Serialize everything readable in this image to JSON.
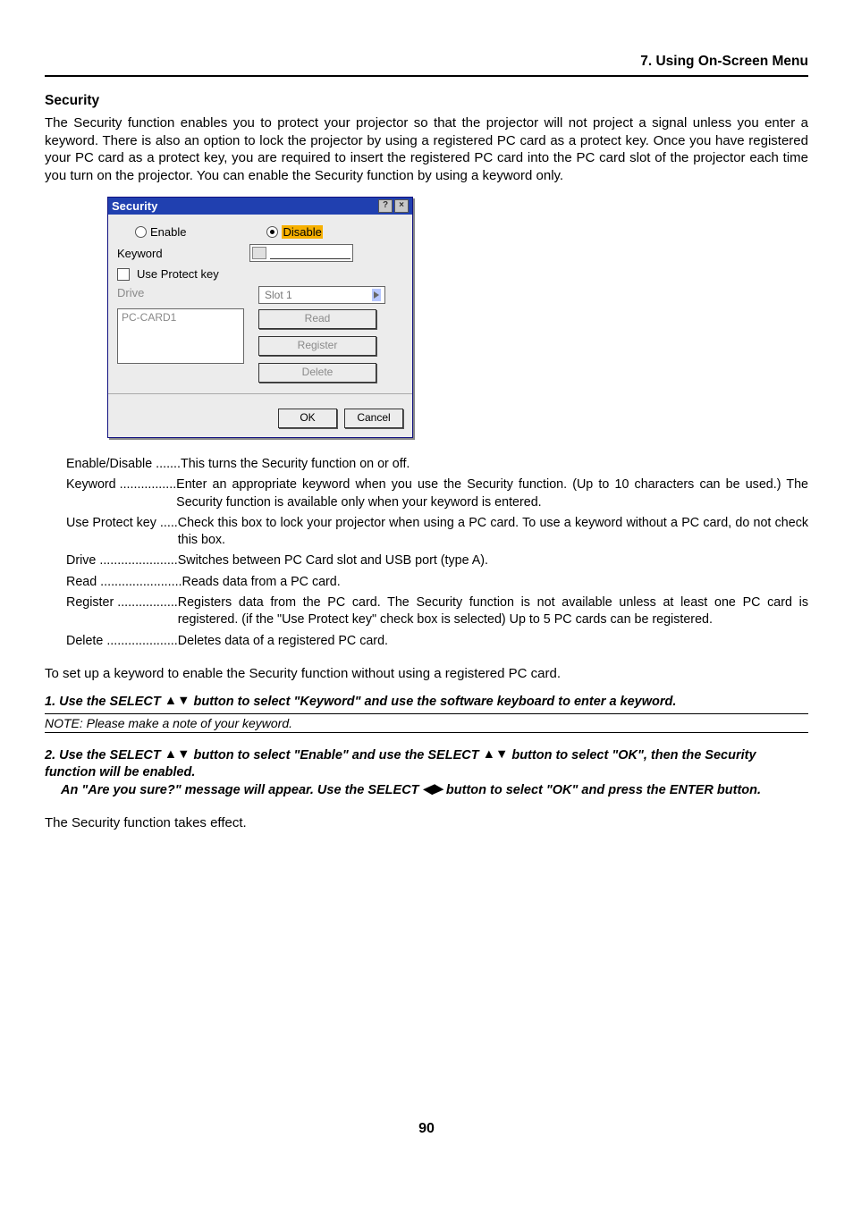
{
  "chapter": "7. Using On-Screen Menu",
  "section_title": "Security",
  "intro_paragraph": "The Security function enables you to protect your projector so that the projector will not project a signal unless you enter a keyword. There is also an option to lock the projector by using a registered PC card as a protect key. Once you have registered your PC card as a protect key, you are required to insert the registered PC card into the PC card slot of the projector each time you turn on the projector. You can enable the Security function by using a keyword only.",
  "dialog": {
    "title": "Security",
    "help_icon": "?",
    "close_icon": "×",
    "enable_label": "Enable",
    "disable_label": "Disable",
    "keyword_label": "Keyword",
    "use_protect_key_label": "Use Protect key",
    "drive_label": "Drive",
    "slot_value": "Slot 1",
    "drive_item": "PC-CARD1",
    "read_btn": "Read",
    "register_btn": "Register",
    "delete_btn": "Delete",
    "ok_btn": "OK",
    "cancel_btn": "Cancel"
  },
  "definitions": [
    {
      "term": "Enable/Disable",
      "dots": ".......",
      "desc": "This turns the Security function on or off."
    },
    {
      "term": "Keyword",
      "dots": "................",
      "desc": "Enter an appropriate keyword when you use the Security function. (Up to 10 characters can be used.) The Security function is available only when your keyword is entered."
    },
    {
      "term": "Use Protect key",
      "dots": ".....",
      "desc": "Check this box to lock your projector when using a PC card. To use a keyword without a PC card, do not check this box."
    },
    {
      "term": "Drive",
      "dots": "......................",
      "desc": "Switches between PC Card slot and USB port (type A)."
    },
    {
      "term": "Read",
      "dots": ".......................",
      "desc": "Reads data from a PC card."
    },
    {
      "term": "Register",
      "dots": ".................",
      "desc": "Registers data from the PC card. The Security function is not available unless at least one PC card is registered. (if the \"Use Protect key\" check box is selected) Up to 5 PC cards can be registered."
    },
    {
      "term": "Delete",
      "dots": "....................",
      "desc": "Deletes data of a registered PC card."
    }
  ],
  "step_intro": "To set up a keyword to enable the Security function without using a registered PC card.",
  "step1_a": "1. Use the SELECT ",
  "step1_b": " button to select \"Keyword\" and use the software keyboard to enter a keyword.",
  "note": "NOTE: Please make a note of your keyword.",
  "step2_a": "2. Use the SELECT ",
  "step2_b": " button to select \"Enable\" and use the SELECT ",
  "step2_c": " button to select \"OK\", then the Security function will be enabled.",
  "step2_sub_a": "An \"Are you sure?\" message will appear. Use the SELECT ",
  "step2_sub_b": " button to select \"OK\" and press the ENTER button.",
  "final_line": "The Security function takes effect.",
  "page_number": "90"
}
